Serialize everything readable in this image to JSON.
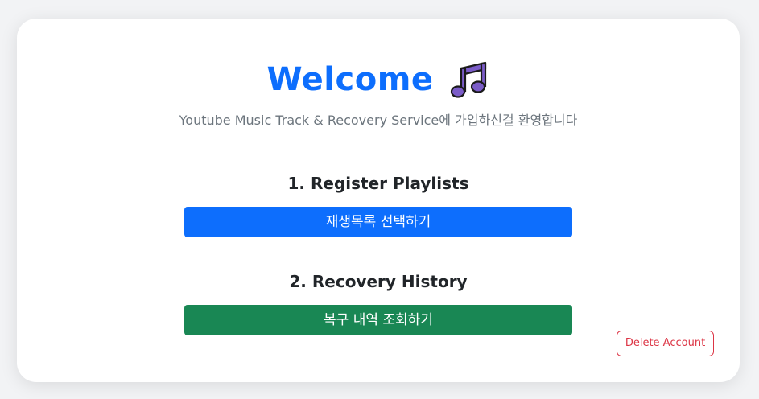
{
  "header": {
    "title": "Welcome",
    "icon": "music-note-icon",
    "subtitle": "Youtube Music Track & Recovery Service에 가입하신걸 환영합니다"
  },
  "steps": [
    {
      "heading": "1. Register Playlists",
      "button_label": "재생목록 선택하기",
      "button_color": "#0d6efd"
    },
    {
      "heading": "2. Recovery History",
      "button_label": "복구 내역 조회하기",
      "button_color": "#198754"
    }
  ],
  "account": {
    "delete_label": "Delete Account",
    "delete_color": "#dc3545"
  },
  "colors": {
    "accent": "#0d6efd",
    "background": "#f2f3f5",
    "card": "#ffffff"
  }
}
